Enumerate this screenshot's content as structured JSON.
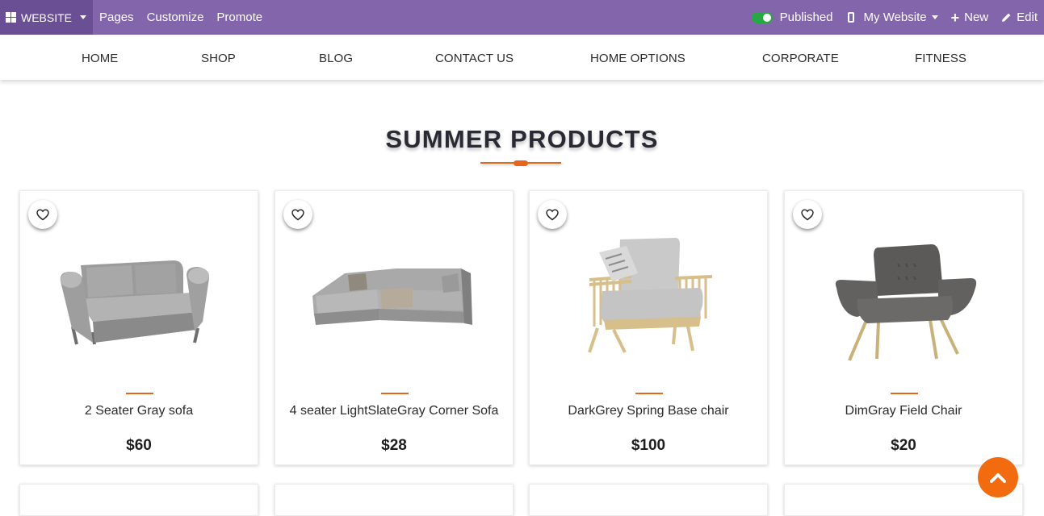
{
  "adminbar": {
    "website_label": "WEBSITE",
    "links": [
      "Pages",
      "Customize",
      "Promote"
    ],
    "published_label": "Published",
    "my_website_label": "My Website",
    "new_label": "New",
    "edit_label": "Edit",
    "bg_color": "#8265ab",
    "toggle_color": "#28a745"
  },
  "nav": {
    "items": [
      "HOME",
      "SHOP",
      "BLOG",
      "CONTACT US",
      "HOME OPTIONS",
      "CORPORATE",
      "FITNESS"
    ]
  },
  "section": {
    "title": "SUMMER PRODUCTS",
    "accent_color": "#e8661c"
  },
  "products": [
    {
      "name": "2 Seater Gray sofa",
      "price": "$60",
      "image_icon": "gray-sofa-image"
    },
    {
      "name": "4 seater LightSlateGray Corner Sofa",
      "price": "$28",
      "image_icon": "corner-sofa-image"
    },
    {
      "name": "DarkGrey Spring Base chair",
      "price": "$100",
      "image_icon": "spring-chair-image"
    },
    {
      "name": "DimGray Field Chair",
      "price": "$20",
      "image_icon": "field-chair-image"
    }
  ],
  "icons": {
    "wishlist": "heart-icon",
    "scroll_top": "chevron-up-icon",
    "scroll_top_color": "#f26b0f"
  }
}
